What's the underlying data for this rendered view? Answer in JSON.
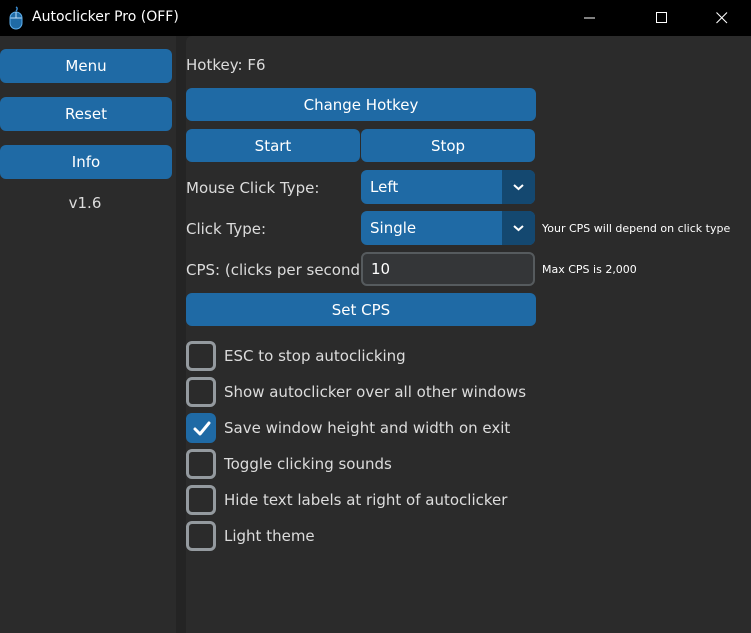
{
  "window": {
    "title": "Autoclicker Pro (OFF)",
    "icon": "mouse-icon"
  },
  "sidebar": {
    "menu_label": "Menu",
    "reset_label": "Reset",
    "info_label": "Info",
    "version": "v1.6"
  },
  "main": {
    "hotkey_label": "Hotkey: F6",
    "change_hotkey_label": "Change Hotkey",
    "start_label": "Start",
    "stop_label": "Stop",
    "mouse_click_type_label": "Mouse Click Type:",
    "mouse_click_type_value": "Left",
    "click_type_label": "Click Type:",
    "click_type_value": "Single",
    "click_type_hint": "Your CPS will depend on click type",
    "cps_label": "CPS: (clicks per second)",
    "cps_value": "10",
    "cps_hint": "Max CPS is 2,000",
    "set_cps_label": "Set CPS"
  },
  "options": [
    {
      "label": "ESC to stop autoclicking",
      "checked": false
    },
    {
      "label": "Show autoclicker over all other windows",
      "checked": false
    },
    {
      "label": "Save window height and width on exit",
      "checked": true
    },
    {
      "label": "Toggle clicking sounds",
      "checked": false
    },
    {
      "label": "Hide text labels at right of autoclicker",
      "checked": false
    },
    {
      "label": "Light theme",
      "checked": false
    }
  ],
  "colors": {
    "accent": "#1f6aa5",
    "accent_dark": "#144870",
    "background": "#242424",
    "panel": "#2b2b2b",
    "titlebar": "#000000"
  }
}
